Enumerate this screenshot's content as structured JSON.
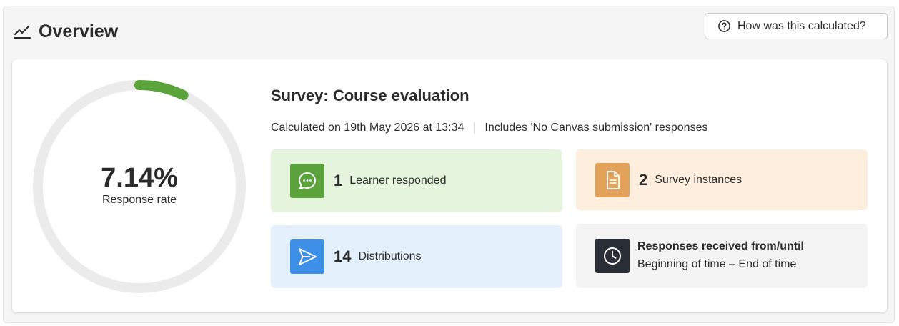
{
  "header": {
    "title": "Overview",
    "icon": "line-chart-icon",
    "help_button": {
      "label": "How was this calculated?",
      "icon": "question-circle-icon"
    }
  },
  "gauge": {
    "value_text": "7.14%",
    "label": "Response rate",
    "fraction": 0.0714,
    "track_color": "#ebebeb",
    "fill_color": "#5ba33b"
  },
  "survey": {
    "title": "Survey: Course evaluation",
    "calculated": "Calculated on 19th May 2026 at 13:34",
    "includes": "Includes 'No Canvas submission' responses"
  },
  "stats": {
    "learners": {
      "number": "1",
      "label": "Learner responded",
      "icon": "chat-bubble-icon",
      "icon_color": "#5ba33b"
    },
    "instances": {
      "number": "2",
      "label": "Survey instances",
      "icon": "document-icon",
      "icon_color": "#e3a25a"
    },
    "distributions": {
      "number": "14",
      "label": "Distributions",
      "icon": "send-icon",
      "icon_color": "#3d8fe8"
    },
    "range": {
      "title": "Responses received from/until",
      "value": "Beginning of time – End of time",
      "icon": "clock-icon",
      "icon_color": "#2a2e37"
    }
  }
}
